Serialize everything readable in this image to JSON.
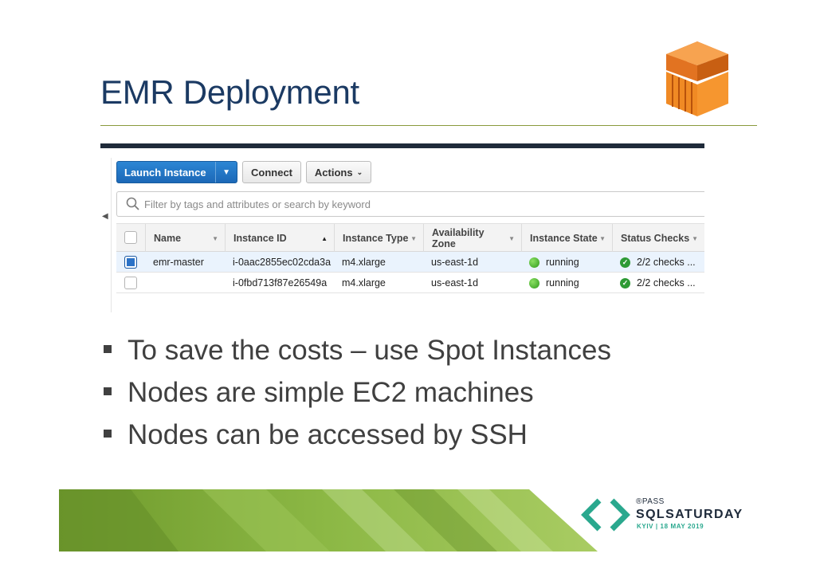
{
  "slide": {
    "title": "EMR Deployment",
    "bullets": [
      "To save the costs – use Spot Instances",
      "Nodes are simple EC2 machines",
      "Nodes can be accessed by SSH"
    ]
  },
  "console": {
    "toolbar": {
      "launch_label": "Launch Instance",
      "connect_label": "Connect",
      "actions_label": "Actions"
    },
    "filter": {
      "placeholder": "Filter by tags and attributes or search by keyword"
    },
    "table": {
      "columns": [
        "Name",
        "Instance ID",
        "Instance Type",
        "Availability Zone",
        "Instance State",
        "Status Checks"
      ],
      "rows": [
        {
          "selected": true,
          "name": "emr-master",
          "instance_id": "i-0aac2855ec02cda3a",
          "type": "m4.xlarge",
          "zone": "us-east-1d",
          "state": "running",
          "checks": "2/2 checks ..."
        },
        {
          "selected": false,
          "name": "",
          "instance_id": "i-0fbd713f87e26549a",
          "type": "m4.xlarge",
          "zone": "us-east-1d",
          "state": "running",
          "checks": "2/2 checks ..."
        }
      ]
    }
  },
  "footer": {
    "pass_mark": "®PASS",
    "brand": "SQLSATURDAY",
    "event": "KYIV | 18 MAY 2019"
  },
  "colors": {
    "title": "#1b3a63",
    "primary_button": "#1c68b7",
    "running": "#2f9a1c",
    "footer_green": "#7aa838",
    "brand_teal": "#2aa88e",
    "emr_orange": "#f08a24"
  },
  "icons": [
    "emr-logo-icon",
    "search-icon",
    "chevron-down-icon",
    "sort-icon",
    "status-running-icon",
    "check-icon",
    "sqlsaturday-logo-icon"
  ]
}
